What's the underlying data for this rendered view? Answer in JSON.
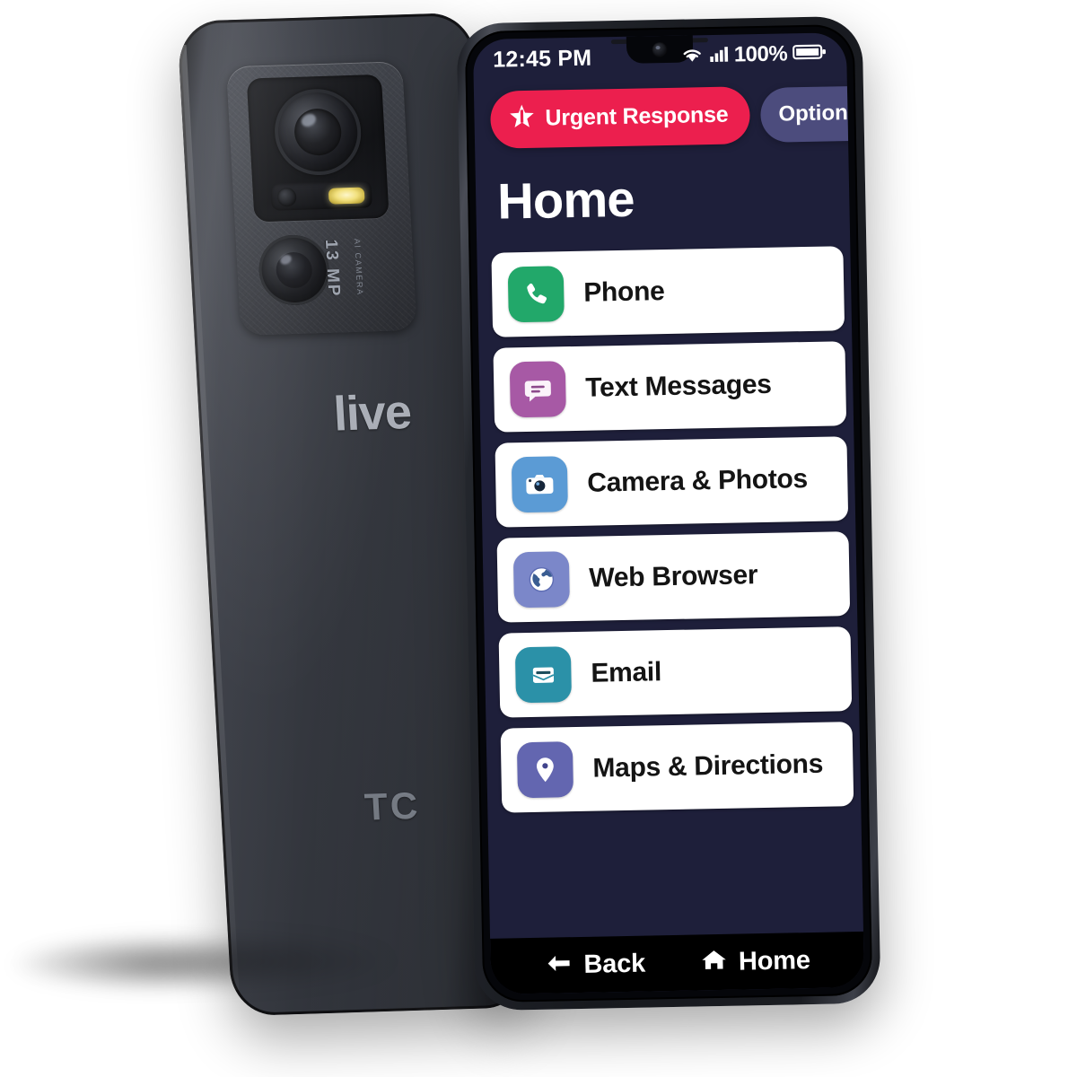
{
  "scene": {
    "product": "Lively Smart senior smartphone (TCL), front and back views"
  },
  "back_phone": {
    "camera_mp_label": "13 MP",
    "camera_mp_sub": "AI CAMERA",
    "brand_front_label": "live",
    "brand_bottom_label": "TC",
    "icons": {
      "main_lens": "camera-lens-icon",
      "secondary_lens": "camera-lens-small-icon",
      "flash": "camera-flash-icon"
    }
  },
  "front_phone": {
    "status_bar": {
      "time": "12:45 PM",
      "battery_percent": "100%",
      "wifi_icon": "wifi-icon",
      "signal_icon": "signal-bars-icon",
      "battery_icon": "battery-full-icon"
    },
    "actions": {
      "urgent_label": "Urgent Response",
      "urgent_icon": "star-icon",
      "urgent_color": "#ec1f4e",
      "options_label": "Options",
      "options_color": "#4c4c7d"
    },
    "page_title": "Home",
    "screen_background": "#1e1f3a",
    "apps": [
      {
        "label": "Phone",
        "icon": "phone-handset-icon",
        "color": "#22a86a"
      },
      {
        "label": "Text Messages",
        "icon": "chat-bubble-icon",
        "color": "#a759a5"
      },
      {
        "label": "Camera & Photos",
        "icon": "camera-icon",
        "color": "#5b9bd5"
      },
      {
        "label": "Web Browser",
        "icon": "globe-icon",
        "color": "#7b87c9"
      },
      {
        "label": "Email",
        "icon": "envelope-icon",
        "color": "#2b91a8"
      },
      {
        "label": "Maps & Directions",
        "icon": "map-pin-icon",
        "color": "#6366b0"
      }
    ],
    "navbar": {
      "back_label": "Back",
      "back_icon": "arrow-left-icon",
      "home_label": "Home",
      "home_icon": "house-icon"
    }
  }
}
